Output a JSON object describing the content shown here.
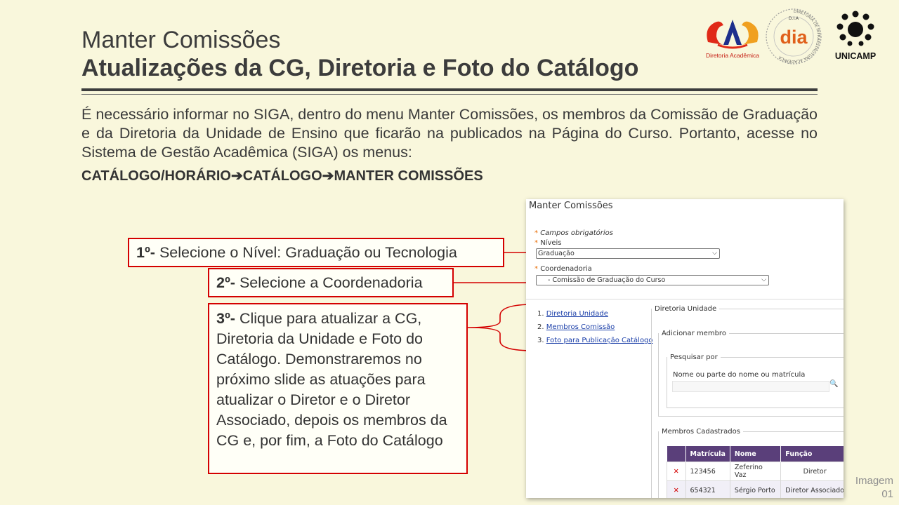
{
  "header": {
    "title_line1": "Manter Comissões",
    "title_line2": "Atualizações da CG, Diretoria e Foto do Catálogo"
  },
  "logos": {
    "diretoria_academica": "Diretoria Acadêmica",
    "dia_text": "dia",
    "dia_ring_text": "DIRETORIA DE INFRAESTRUTURA ACADÊMICA",
    "dia_top": "D.I.A",
    "unicamp": "UNICAMP"
  },
  "intro": {
    "text": "É necessário informar no SIGA, dentro do menu Manter Comissões, os membros da Comissão de Graduação e da Diretoria da Unidade de Ensino que ficarão na publicados na Página do Curso. Portanto, acesse no Sistema de Gestão Acadêmica (SIGA) os menus:",
    "menu_1": "CATÁLOGO/HORÁRIO",
    "menu_2": "CATÁLOGO",
    "menu_3": "MANTER COMISSÕES"
  },
  "callouts": {
    "step1_num": "1º-",
    "step1_text": " Selecione o Nível: Graduação ou Tecnologia",
    "step2_num": "2º-",
    "step2_text": " Selecione a Coordenadoria",
    "step3_num": "3º-",
    "step3_text": " Clique para atualizar a CG, Diretoria da Unidade e Foto do Catálogo. Demonstraremos no próximo slide as atuações para atualizar o Diretor e o Diretor Associado, depois os membros da CG e, por fim, a Foto do Catálogo"
  },
  "siga": {
    "page_title": "Manter Comissões",
    "required_note": "Campos obrigatórios",
    "niveis_label": "Níveis",
    "niveis_value": "Graduação",
    "coord_label": "Coordenadoria",
    "coord_value": "- Comissão de Graduação do Curso",
    "nav": [
      {
        "num": "1.",
        "label": "Diretoria Unidade"
      },
      {
        "num": "2.",
        "label": "Membros Comissão"
      },
      {
        "num": "3.",
        "label": "Foto para Publicação Catálogo"
      }
    ],
    "fs_diretoria": "Diretoria Unidade",
    "fs_adicionar": "Adicionar membro",
    "fs_pesquisar": "Pesquisar por",
    "search_label": "Nome ou parte do nome ou matrícula",
    "search_value": "",
    "fs_membros": "Membros Cadastrados",
    "table": {
      "headers": [
        "Matrícula",
        "Nome",
        "Função"
      ],
      "rows": [
        {
          "matricula": "123456",
          "nome": "Zeferino Vaz",
          "funcao": "Diretor"
        },
        {
          "matricula": "654321",
          "nome": "Sérgio Porto",
          "funcao": "Diretor Associado"
        }
      ]
    }
  },
  "footer": {
    "label_1": "Imagem",
    "label_2": "01"
  },
  "colors": {
    "background": "#f9f7dc",
    "callout_border": "#d40000",
    "table_header": "#5a3f7a",
    "link": "#1a3ea8"
  }
}
